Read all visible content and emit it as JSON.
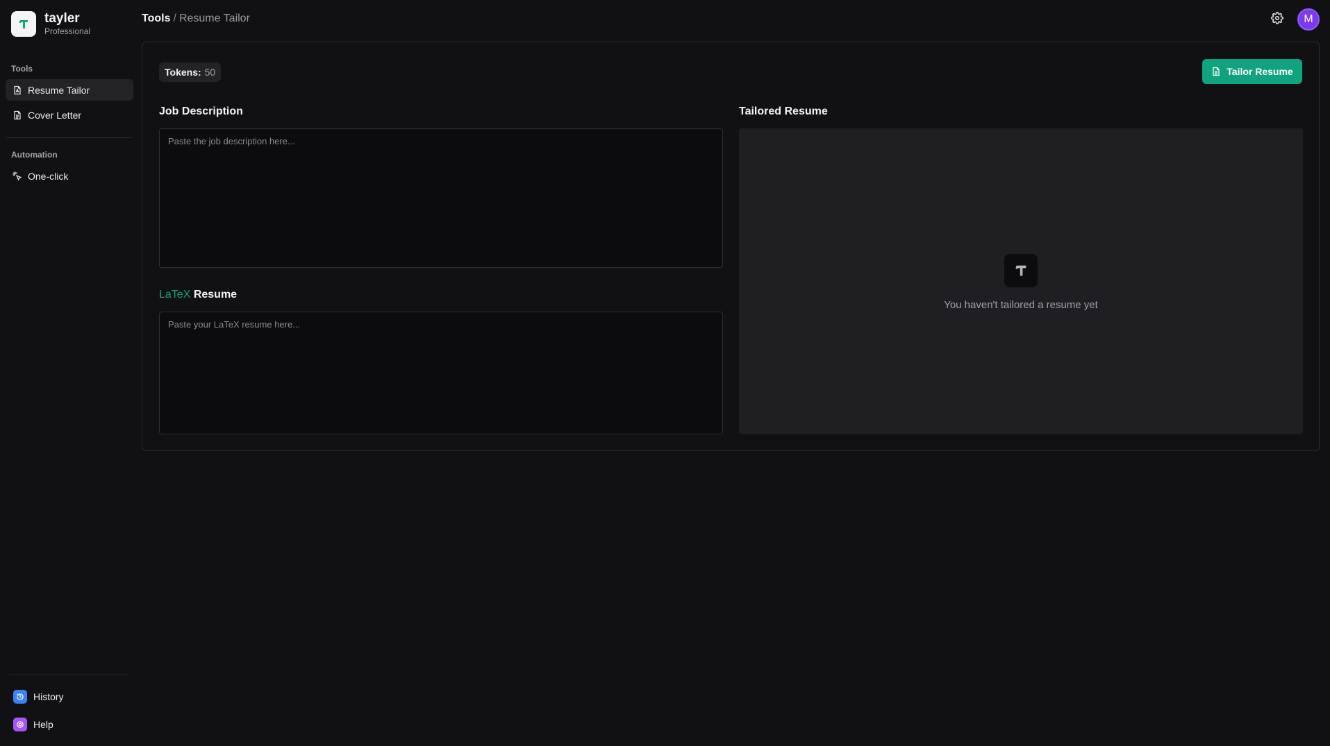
{
  "brand": {
    "name": "tayler",
    "plan": "Professional"
  },
  "sidebar": {
    "sections": [
      {
        "title": "Tools",
        "items": [
          {
            "label": "Resume Tailor",
            "icon": "file-text-icon",
            "active": true
          },
          {
            "label": "Cover Letter",
            "icon": "file-icon",
            "active": false
          }
        ]
      },
      {
        "title": "Automation",
        "items": [
          {
            "label": "One-click",
            "icon": "sparkle-click-icon",
            "active": false
          }
        ]
      }
    ],
    "bottom": [
      {
        "label": "History",
        "icon": "history-icon",
        "color": "#3b82f6"
      },
      {
        "label": "Help",
        "icon": "help-icon",
        "color": "#a855f7"
      }
    ]
  },
  "breadcrumb": {
    "root": "Tools",
    "separator": "/",
    "current": "Resume Tailor"
  },
  "header": {
    "avatar_initial": "M",
    "avatar_color": "#7c3aed"
  },
  "main": {
    "tokens": {
      "label": "Tokens:",
      "value": "50"
    },
    "tailor_button": {
      "label": "Tailor Resume",
      "color": "#10a37f"
    },
    "job_description": {
      "label": "Job Description",
      "placeholder": "Paste the job description here...",
      "value": ""
    },
    "latex_resume": {
      "label_accent": "LaTeX",
      "label_rest": "Resume",
      "placeholder": "Paste your LaTeX resume here...",
      "value": ""
    },
    "tailored_resume": {
      "label": "Tailored Resume",
      "empty_text": "You haven't tailored a resume yet"
    }
  },
  "colors": {
    "accent": "#10a37f",
    "background": "#111114",
    "surface": "#1f1f23"
  }
}
